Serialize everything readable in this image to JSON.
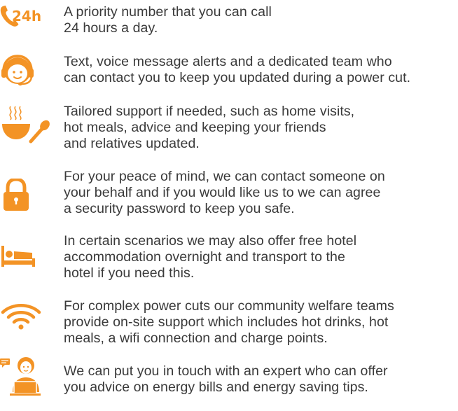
{
  "accent_color": "#f39325",
  "text_color": "#3a3a3a",
  "items": [
    {
      "icon": "phone-24-hours-icon",
      "icon_label": "24h",
      "lines": [
        "A priority number that you can call",
        "24 hours a day."
      ]
    },
    {
      "icon": "headset-agent-icon",
      "lines": [
        "Text, voice message alerts and a dedicated team who",
        "can contact you to keep you updated during a power cut."
      ]
    },
    {
      "icon": "hot-soup-bowl-icon",
      "lines": [
        "Tailored support if needed, such as home visits,",
        "hot meals, advice and keeping your friends",
        "and relatives updated."
      ]
    },
    {
      "icon": "padlock-icon",
      "lines": [
        "For your peace of mind, we can contact someone on",
        "your behalf and if you would like us to we can agree",
        "a security password to keep you safe."
      ]
    },
    {
      "icon": "hotel-bed-icon",
      "lines": [
        "In certain scenarios we may also offer free hotel",
        "accommodation overnight and transport to the",
        "hotel if you need this."
      ]
    },
    {
      "icon": "wifi-icon",
      "lines": [
        "For complex power cuts our community welfare teams",
        "provide on-site support which includes hot drinks, hot",
        "meals, a wifi connection and charge points."
      ]
    },
    {
      "icon": "energy-expert-laptop-icon",
      "lines": [
        "We can put you in touch with an expert who can offer",
        "you advice on energy bills and energy saving tips."
      ]
    }
  ]
}
